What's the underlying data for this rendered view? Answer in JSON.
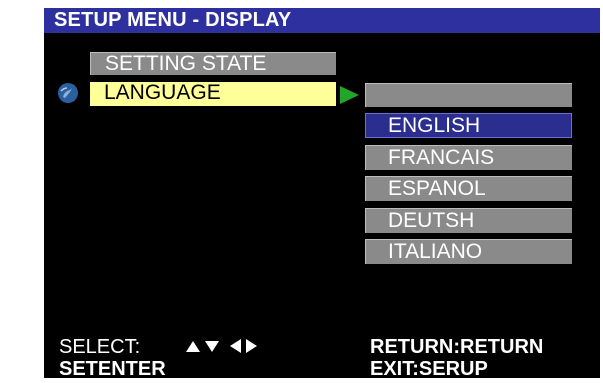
{
  "title": "SETUP MENU - DISPLAY",
  "menu": {
    "items": [
      {
        "label": "SETTING STATE"
      },
      {
        "label": "LANGUAGE"
      }
    ],
    "active_item": "LANGUAGE"
  },
  "language_options": [
    {
      "label": "ENGLISH",
      "selected": true
    },
    {
      "label": "FRANCAIS",
      "selected": false
    },
    {
      "label": "ESPANOL",
      "selected": false
    },
    {
      "label": "DEUTSH",
      "selected": false
    },
    {
      "label": "ITALIANO",
      "selected": false
    }
  ],
  "footer": {
    "select_label": "SELECT:",
    "setenter_label": "SETENTER",
    "return_key": "RETURN",
    "return_action": "RETURN",
    "exit_key": "EXIT",
    "exit_action": "SERUP"
  },
  "icons": {
    "globe": "globe-icon",
    "pointer": "play-arrow-icon",
    "nav": [
      "up-arrow-icon",
      "down-arrow-icon",
      "left-arrow-icon",
      "right-arrow-icon"
    ]
  },
  "colors": {
    "background": "#000000",
    "title_bar": "#2f30a0",
    "highlight": "#ffff99",
    "item_gray": "#8a8a8a",
    "selected_option": "#2b2d8f",
    "arrow_green": "#21a62a",
    "text": "#ffffff"
  }
}
